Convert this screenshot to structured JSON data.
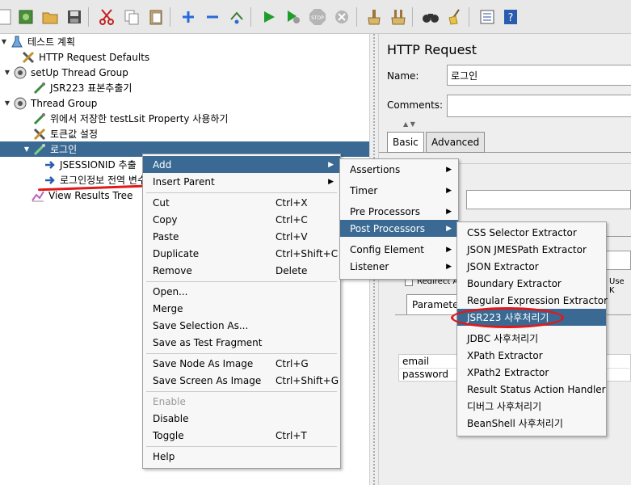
{
  "toolbar": {
    "icons": [
      "new-icon",
      "templates-icon",
      "open-icon",
      "save-icon",
      "cut-icon",
      "copy-icon",
      "paste-icon",
      "expand-icon",
      "collapse-icon",
      "toggle-icon",
      "start-icon",
      "start-no-pause-icon",
      "stop-icon",
      "shutdown-icon",
      "clear-icon",
      "clear-all-icon",
      "search-icon",
      "broom-icon",
      "function-helper-icon",
      "help-icon"
    ]
  },
  "tree": {
    "items": [
      {
        "label": "테스트 계획",
        "icon": "test-plan-icon"
      },
      {
        "label": "HTTP Request Defaults",
        "icon": "config-icon"
      },
      {
        "label": "setUp Thread Group",
        "icon": "thread-group-icon"
      },
      {
        "label": "JSR223 표본추출기",
        "icon": "sampler-icon"
      },
      {
        "label": "Thread Group",
        "icon": "thread-group-icon"
      },
      {
        "label": "위에서 저장한 testLsit  Property 사용하기",
        "icon": "sampler-icon"
      },
      {
        "label": "토큰값 설정",
        "icon": "config-icon"
      },
      {
        "label": "로그인",
        "icon": "sampler-icon"
      },
      {
        "label": "JSESSIONID 추출",
        "icon": "post-processor-icon"
      },
      {
        "label": "로그인정보 전역 변수",
        "icon": "post-processor-icon"
      },
      {
        "label": "View Results Tree",
        "icon": "listener-icon"
      }
    ]
  },
  "right_panel": {
    "title": "HTTP Request",
    "name_label": "Name:",
    "name_value": "로그인",
    "comments_label": "Comments:",
    "tabs": [
      "Basic",
      "Advanced"
    ],
    "redirect_label": "Redirect A",
    "use_keepalive_label": "Use K",
    "param_tab": "Paramete",
    "params": [
      "email",
      "password"
    ]
  },
  "menu1": {
    "items": [
      {
        "label": "Add",
        "shortcut": "",
        "submenu": true
      },
      {
        "label": "Insert Parent",
        "shortcut": "",
        "submenu": true
      },
      {
        "label": "Cut",
        "shortcut": "Ctrl+X"
      },
      {
        "label": "Copy",
        "shortcut": "Ctrl+C"
      },
      {
        "label": "Paste",
        "shortcut": "Ctrl+V"
      },
      {
        "label": "Duplicate",
        "shortcut": "Ctrl+Shift+C"
      },
      {
        "label": "Remove",
        "shortcut": "Delete"
      },
      {
        "label": "Open...",
        "shortcut": ""
      },
      {
        "label": "Merge",
        "shortcut": ""
      },
      {
        "label": "Save Selection As...",
        "shortcut": ""
      },
      {
        "label": "Save as Test Fragment",
        "shortcut": ""
      },
      {
        "label": "Save Node As Image",
        "shortcut": "Ctrl+G"
      },
      {
        "label": "Save Screen As Image",
        "shortcut": "Ctrl+Shift+G"
      },
      {
        "label": "Enable",
        "shortcut": ""
      },
      {
        "label": "Disable",
        "shortcut": ""
      },
      {
        "label": "Toggle",
        "shortcut": "Ctrl+T"
      },
      {
        "label": "Help",
        "shortcut": ""
      }
    ]
  },
  "menu2": {
    "items": [
      "Assertions",
      "Timer",
      "Pre Processors",
      "Post Processors",
      "Config Element",
      "Listener"
    ]
  },
  "menu3": {
    "items": [
      "CSS Selector Extractor",
      "JSON JMESPath Extractor",
      "JSON Extractor",
      "Boundary Extractor",
      "Regular Expression Extractor",
      "JSR223 사후처리기",
      "JDBC 사후처리기",
      "XPath Extractor",
      "XPath2 Extractor",
      "Result Status Action Handler",
      "디버그 사후처리기",
      "BeanShell 사후처리기"
    ]
  },
  "colors": {
    "selection": "#3a6a93",
    "annotation": "#e0191b"
  }
}
